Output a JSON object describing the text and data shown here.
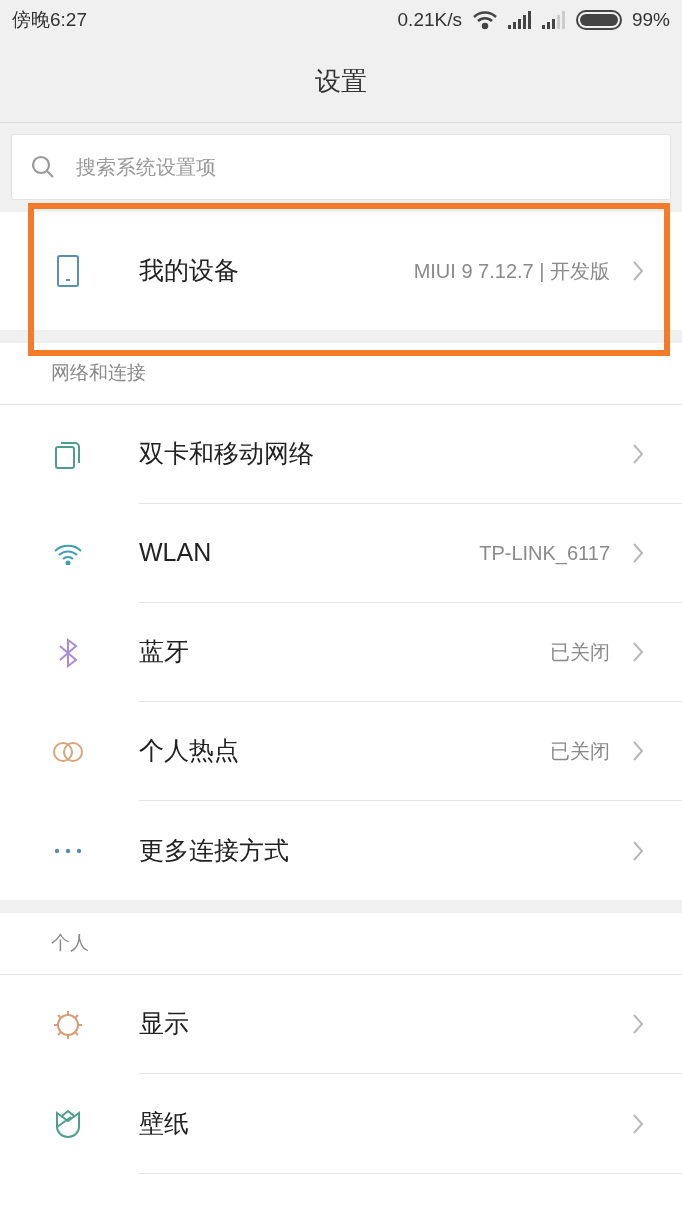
{
  "status_bar": {
    "time": "傍晚6:27",
    "speed": "0.21K/s",
    "battery": "99%"
  },
  "title": "设置",
  "search": {
    "placeholder": "搜索系统设置项"
  },
  "groups": [
    {
      "items": [
        {
          "kind": "device",
          "label": "我的设备",
          "value": "MIUI 9 7.12.7 | 开发版",
          "highlighted": true
        }
      ]
    },
    {
      "header": "网络和连接",
      "items": [
        {
          "kind": "sim",
          "label": "双卡和移动网络"
        },
        {
          "kind": "wifi",
          "label": "WLAN",
          "value": "TP-LINK_6117"
        },
        {
          "kind": "bluetooth",
          "label": "蓝牙",
          "value": "已关闭"
        },
        {
          "kind": "hotspot",
          "label": "个人热点",
          "value": "已关闭"
        },
        {
          "kind": "more",
          "label": "更多连接方式"
        }
      ]
    },
    {
      "header": "个人",
      "items": [
        {
          "kind": "display",
          "label": "显示"
        },
        {
          "kind": "wallpaper",
          "label": "壁纸"
        }
      ]
    }
  ]
}
